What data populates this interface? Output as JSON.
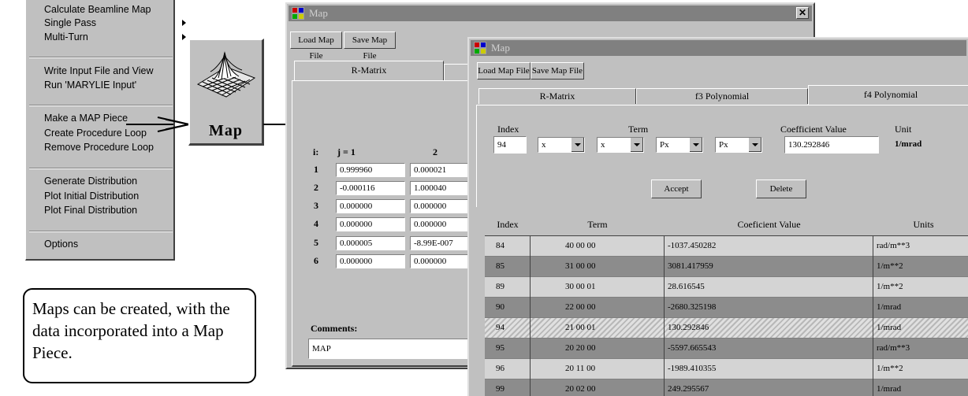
{
  "menu": {
    "items": [
      {
        "label": "Calculate Beamline Map",
        "submenu": false
      },
      {
        "label": "Single Pass",
        "submenu": true
      },
      {
        "label": "Multi-Turn",
        "submenu": true
      },
      {
        "label": "Write Input File and View",
        "submenu": false
      },
      {
        "label": "Run 'MARYLIE Input'",
        "submenu": false
      },
      {
        "label": "Make a MAP Piece",
        "submenu": false
      },
      {
        "label": "Create Procedure Loop",
        "submenu": false
      },
      {
        "label": "Remove Procedure Loop",
        "submenu": false
      },
      {
        "label": "Generate Distribution",
        "submenu": false
      },
      {
        "label": "Plot Initial Distribution",
        "submenu": false
      },
      {
        "label": "Plot Final Distribution",
        "submenu": false
      },
      {
        "label": "Options",
        "submenu": false
      }
    ]
  },
  "map_icon": {
    "label": "Map",
    "icon": "surface-plot-icon"
  },
  "caption": "Maps can be created, with the data incorporated into a Map Piece.",
  "back_window": {
    "title": "Map",
    "load_button": "Load Map File",
    "save_button": "Save Map File",
    "tab_rmatrix": "R-Matrix",
    "header_i": "i:",
    "header_j1": "j = 1",
    "header_j2": "2",
    "row_labels": [
      "1",
      "2",
      "3",
      "4",
      "5",
      "6"
    ],
    "col1": [
      "0.999960",
      "-0.000116",
      "0.000000",
      "0.000000",
      "0.000005",
      "0.000000"
    ],
    "col2": [
      "0.000021",
      "1.000040",
      "0.000000",
      "0.000000",
      "-8.99E-007",
      "0.000000"
    ],
    "comments_label": "Comments:",
    "comments_value": "MAP"
  },
  "front_window": {
    "title": "Map",
    "load_button": "Load Map File",
    "save_button": "Save Map File",
    "tabs": [
      "R-Matrix",
      "f3 Polynomial",
      "f4 Polynomial"
    ],
    "index_label": "Index",
    "term_label": "Term",
    "coef_label": "Coefficient Value",
    "unit_label": "Unit",
    "index_value": "94",
    "term_values": [
      "x",
      "x",
      "Px",
      "Px"
    ],
    "coef_value": "130.292846",
    "unit_value": "1/mrad",
    "accept_button": "Accept",
    "delete_button": "Delete",
    "table": {
      "headers": [
        "Index",
        "Term",
        "Coeficient Value",
        "Units"
      ],
      "rows": [
        {
          "index": "84",
          "term": "40  00  00",
          "value": "-1037.450282",
          "units": "rad/m**3"
        },
        {
          "index": "85",
          "term": "31  00  00",
          "value": "3081.417959",
          "units": "1/m**2"
        },
        {
          "index": "89",
          "term": "30  00  01",
          "value": "28.616545",
          "units": "1/m**2"
        },
        {
          "index": "90",
          "term": "22  00  00",
          "value": "-2680.325198",
          "units": "1/mrad"
        },
        {
          "index": "94",
          "term": "21  00  01",
          "value": "130.292846",
          "units": "1/mrad"
        },
        {
          "index": "95",
          "term": "20  20  00",
          "value": "-5597.665543",
          "units": "rad/m**3"
        },
        {
          "index": "96",
          "term": "20  11  00",
          "value": "-1989.410355",
          "units": "1/m**2"
        },
        {
          "index": "99",
          "term": "20  02  00",
          "value": "249.295567",
          "units": "1/mrad"
        }
      ]
    }
  }
}
